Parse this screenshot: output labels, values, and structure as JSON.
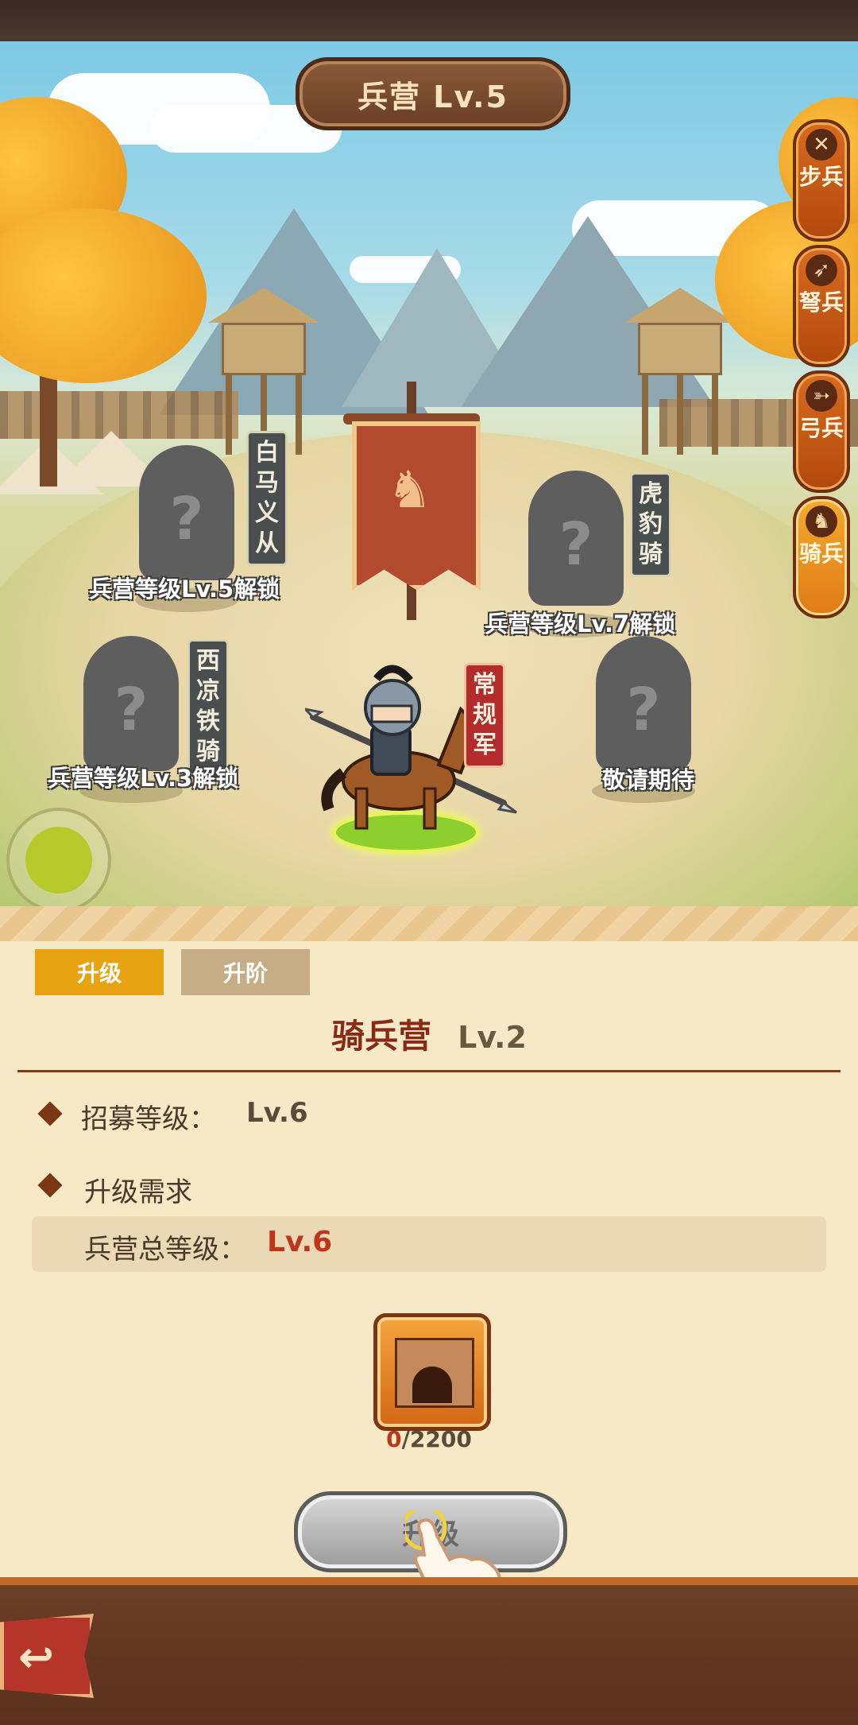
{
  "header": {
    "title": "兵营 Lv.5"
  },
  "side_tabs": [
    {
      "label": "步兵",
      "icon": "crossed-swords-icon",
      "active": false
    },
    {
      "label": "弩兵",
      "icon": "crossbow-icon",
      "active": false
    },
    {
      "label": "弓兵",
      "icon": "bow-icon",
      "active": false
    },
    {
      "label": "骑兵",
      "icon": "horse-icon",
      "active": true
    }
  ],
  "units": {
    "baima": {
      "name": "白马义从",
      "unlock": "兵营等级Lv.5解锁"
    },
    "hubao": {
      "name": "虎豹骑",
      "unlock": "兵营等级Lv.7解锁"
    },
    "xiliang": {
      "name": "西凉铁骑",
      "unlock": "兵营等级Lv.3解锁"
    },
    "regular": {
      "name": "常规军"
    },
    "coming": {
      "unlock": "敬请期待"
    }
  },
  "panel": {
    "tabs": [
      "升级",
      "升阶"
    ],
    "active_tab": "升级",
    "building_name": "骑兵营",
    "building_level": "Lv.2",
    "recruit_label": "招募等级：",
    "recruit_level": "Lv.6",
    "requirement_title": "升级需求",
    "req_label": "兵营总等级：",
    "req_value": "Lv.6",
    "cost_have": "0",
    "cost_need": "/2200",
    "upgrade_button": "升级"
  },
  "colors": {
    "accent": "#e7a311",
    "heading": "#8a2a10",
    "warning": "#c0341a"
  }
}
